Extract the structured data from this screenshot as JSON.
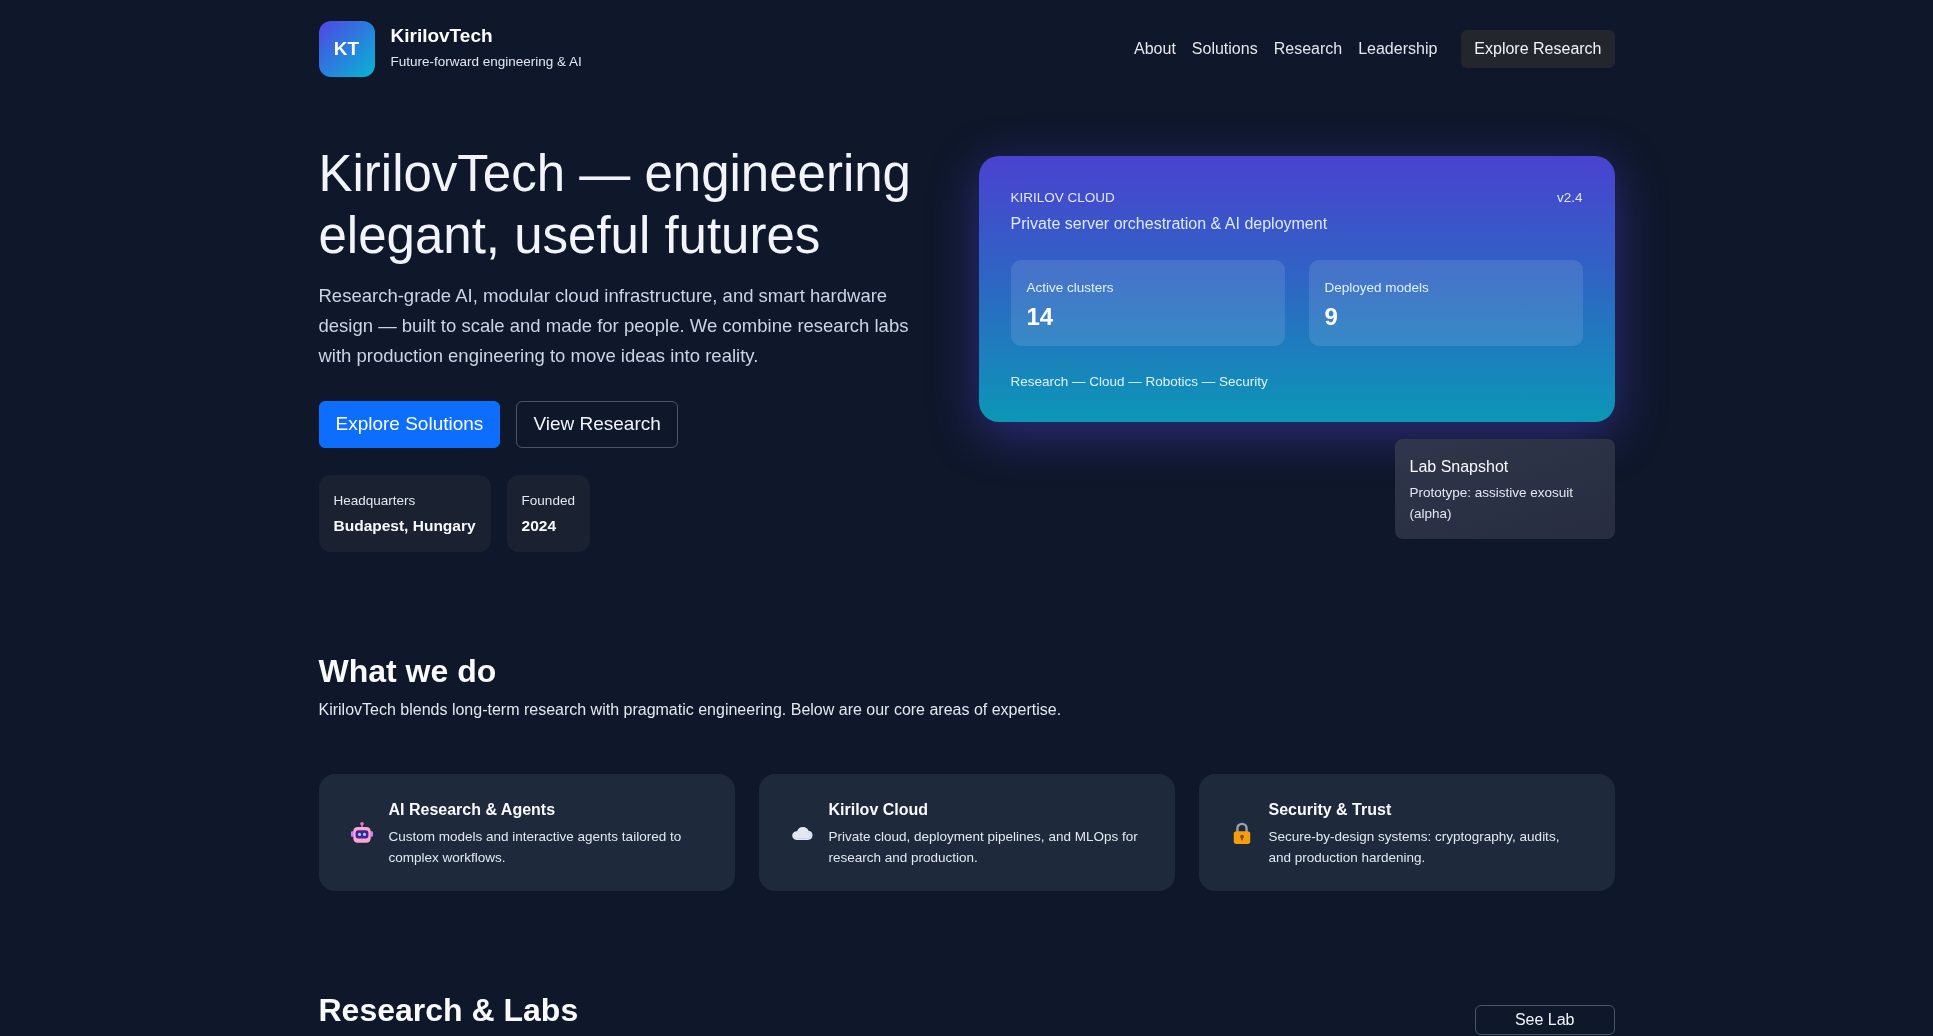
{
  "brand": {
    "logo": "KT",
    "name": "KirilovTech",
    "tagline": "Future-forward engineering & AI"
  },
  "nav": {
    "links": [
      "About",
      "Solutions",
      "Research",
      "Leadership"
    ],
    "cta": "Explore Research"
  },
  "hero": {
    "title": "KirilovTech — engineering elegant, useful futures",
    "lead": "Research-grade AI, modular cloud infrastructure, and smart hardware design — built to scale and made for people. We combine research labs with production engineering to move ideas into reality.",
    "buttons": [
      {
        "label": "Explore Solutions",
        "kind": "primary"
      },
      {
        "label": "View Research",
        "kind": "outline"
      }
    ],
    "facts": [
      {
        "label": "Headquarters",
        "value": "Budapest, Hungary"
      },
      {
        "label": "Founded",
        "value": "2024"
      }
    ]
  },
  "cloud_card": {
    "eyebrow": "KIRILOV CLOUD",
    "version": "v2.4",
    "subtitle": "Private server orchestration & AI deployment",
    "stats": [
      {
        "label": "Active clusters",
        "value": "14"
      },
      {
        "label": "Deployed models",
        "value": "9"
      }
    ],
    "footer": "Research — Cloud — Robotics — Security"
  },
  "lab_snapshot": {
    "title": "Lab Snapshot",
    "text": "Prototype: assistive exosuit (alpha)"
  },
  "what_we_do": {
    "heading": "What we do",
    "intro": "KirilovTech blends long-term research with pragmatic engineering. Below are our core areas of expertise.",
    "services": [
      {
        "kind": "robot",
        "title": "AI Research & Agents",
        "text": "Custom models and interactive agents tailored to complex workflows."
      },
      {
        "kind": "cloud",
        "title": "Kirilov Cloud",
        "text": "Private cloud, deployment pipelines, and MLOps for research and production."
      },
      {
        "kind": "lock",
        "title": "Security & Trust",
        "text": "Secure-by-design systems: cryptography, audits, and production hardening."
      }
    ]
  },
  "research_labs": {
    "heading": "Research & Labs",
    "button": "See Lab"
  }
}
